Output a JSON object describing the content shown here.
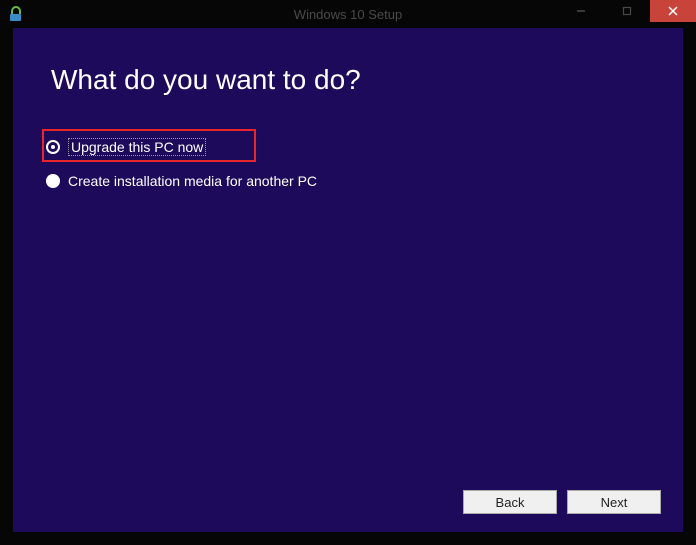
{
  "titlebar": {
    "title": "Windows 10 Setup"
  },
  "content": {
    "heading": "What do you want to do?",
    "options": [
      {
        "label": "Upgrade this PC now",
        "selected": true,
        "highlighted": true
      },
      {
        "label": "Create installation media for another PC",
        "selected": false,
        "highlighted": false
      }
    ]
  },
  "footer": {
    "back_label": "Back",
    "next_label": "Next"
  },
  "colors": {
    "content_bg": "#1e0a5a",
    "highlight": "#e8252a",
    "close_btn": "#c8443b"
  }
}
